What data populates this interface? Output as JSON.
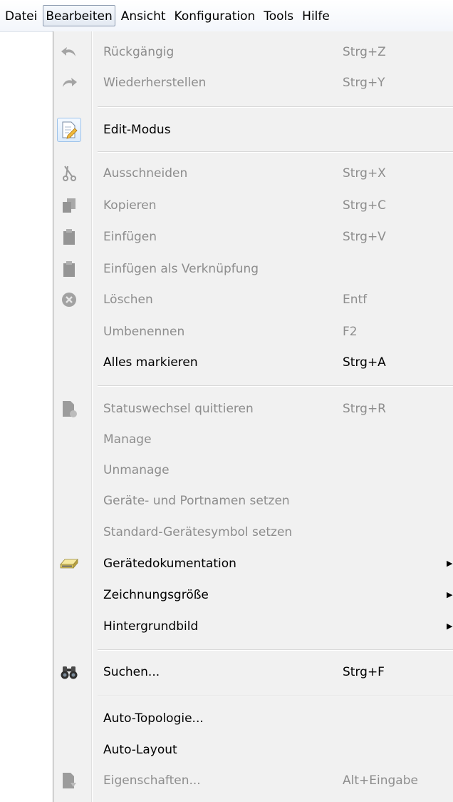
{
  "menubar": {
    "items": [
      {
        "label": "Datei",
        "open": false
      },
      {
        "label": "Bearbeiten",
        "open": true
      },
      {
        "label": "Ansicht",
        "open": false
      },
      {
        "label": "Konfiguration",
        "open": false
      },
      {
        "label": "Tools",
        "open": false
      },
      {
        "label": "Hilfe",
        "open": false
      }
    ]
  },
  "menu": {
    "undo": {
      "label": "Rückgängig",
      "shortcut": "Strg+Z",
      "icon": "undo-icon"
    },
    "redo": {
      "label": "Wiederherstellen",
      "shortcut": "Strg+Y",
      "icon": "redo-icon"
    },
    "edit_mode": {
      "label": "Edit-Modus",
      "icon": "edit-mode-icon"
    },
    "cut": {
      "label": "Ausschneiden",
      "shortcut": "Strg+X",
      "icon": "scissors-icon"
    },
    "copy": {
      "label": "Kopieren",
      "shortcut": "Strg+C",
      "icon": "copy-icon"
    },
    "paste": {
      "label": "Einfügen",
      "shortcut": "Strg+V",
      "icon": "paste-icon"
    },
    "paste_link": {
      "label": "Einfügen als Verknüpfung",
      "icon": "paste-link-icon"
    },
    "delete": {
      "label": "Löschen",
      "shortcut": "Entf",
      "icon": "delete-icon"
    },
    "rename": {
      "label": "Umbenennen",
      "shortcut": "F2"
    },
    "select_all": {
      "label": "Alles markieren",
      "shortcut": "Strg+A"
    },
    "ack_status": {
      "label": "Statuswechsel quittieren",
      "shortcut": "Strg+R",
      "icon": "acknowledge-icon"
    },
    "manage": {
      "label": "Manage"
    },
    "unmanage": {
      "label": "Unmanage"
    },
    "set_names": {
      "label": "Geräte- und Portnamen setzen"
    },
    "set_symbol": {
      "label": "Standard-Gerätesymbol setzen"
    },
    "device_doc": {
      "label": "Gerätedokumentation",
      "icon": "device-documentation-icon"
    },
    "drawing_size": {
      "label": "Zeichnungsgröße"
    },
    "background": {
      "label": "Hintergrundbild"
    },
    "search": {
      "label": "Suchen...",
      "shortcut": "Strg+F",
      "icon": "binoculars-icon"
    },
    "auto_topology": {
      "label": "Auto-Topologie..."
    },
    "auto_layout": {
      "label": "Auto-Layout"
    },
    "properties": {
      "label": "Eigenschaften...",
      "shortcut": "Alt+Eingabe",
      "icon": "properties-icon"
    }
  },
  "colors": {
    "menu_bg": "#f1f1f1",
    "disabled_text": "#8d8d8d",
    "enabled_text": "#000000",
    "highlight_border": "#9ec3ea"
  }
}
